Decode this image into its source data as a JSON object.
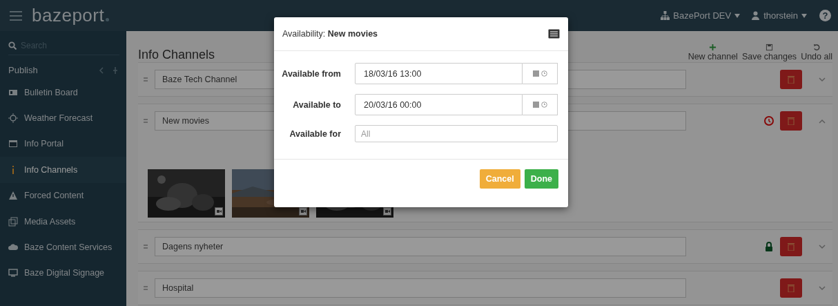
{
  "header": {
    "logo": "bazeport",
    "site": "BazePort DEV",
    "user": "thorstein",
    "help": "?"
  },
  "sidebar": {
    "search_placeholder": "Search",
    "section": "Publish",
    "items": [
      {
        "label": "Bulletin Board",
        "selected": false
      },
      {
        "label": "Weather Forecast",
        "selected": false
      },
      {
        "label": "Info Portal",
        "selected": false
      },
      {
        "label": "Info Channels",
        "selected": true
      },
      {
        "label": "Forced Content",
        "selected": false
      },
      {
        "label": "Media Assets",
        "selected": false
      },
      {
        "label": "Baze Content Services",
        "selected": false
      },
      {
        "label": "Baze Digital Signage",
        "selected": false
      }
    ]
  },
  "page": {
    "title": "Info Channels",
    "actions": [
      {
        "label": "New channel"
      },
      {
        "label": "Save changes"
      },
      {
        "label": "Undo all"
      }
    ]
  },
  "channels": [
    {
      "name": "Baze Tech Channel",
      "kind": "plain",
      "expanded": false
    },
    {
      "name": "New movies",
      "kind": "scheduled",
      "expanded": true
    },
    {
      "name": "Dagens nyheter",
      "kind": "locked",
      "expanded": false
    },
    {
      "name": "Hospital",
      "kind": "plain",
      "expanded": false
    }
  ],
  "dialog": {
    "title": "Availability: **New movies**",
    "fields": [
      {
        "label": "Available from",
        "value": "18/03/16 13:00",
        "kind": "datetime"
      },
      {
        "label": "Available to",
        "value": "20/03/16 00:00",
        "kind": "datetime"
      },
      {
        "label": "Available for",
        "placeholder": "All",
        "kind": "text"
      }
    ],
    "buttons": [
      {
        "label": "Cancel",
        "kind": "cancel"
      },
      {
        "label": "Done",
        "kind": "primary"
      }
    ]
  }
}
